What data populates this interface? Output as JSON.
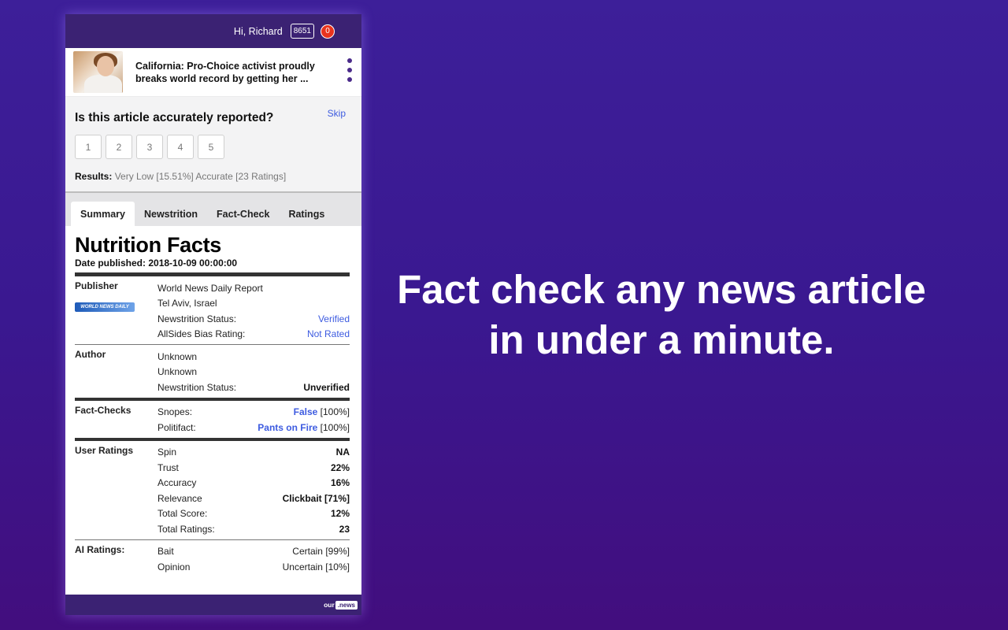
{
  "header": {
    "greeting": "Hi, Richard",
    "points": "8651",
    "notifications": "0"
  },
  "article": {
    "title": "California: Pro-Choice activist proudly breaks world record by getting her ..."
  },
  "rating": {
    "question": "Is this article accurately reported?",
    "skip_label": "Skip",
    "options": [
      "1",
      "2",
      "3",
      "4",
      "5"
    ],
    "results_label": "Results:",
    "results_text": "Very Low [15.51%] Accurate [23 Ratings]"
  },
  "tabs": [
    "Summary",
    "Newstrition",
    "Fact-Check",
    "Ratings"
  ],
  "facts": {
    "title": "Nutrition Facts",
    "date_published": "Date published: 2018-10-09 00:00:00",
    "publisher": {
      "label": "Publisher",
      "logo_text": "WORLD NEWS DAILY REPORT",
      "name": "World News Daily Report",
      "location": "Tel Aviv, Israel",
      "status_label": "Newstrition Status:",
      "status_value": "Verified",
      "bias_label": "AllSides Bias Rating:",
      "bias_value": "Not Rated"
    },
    "author": {
      "label": "Author",
      "name": "Unknown",
      "line2": "Unknown",
      "status_label": "Newstrition Status:",
      "status_value": "Unverified"
    },
    "fact_checks": {
      "label": "Fact-Checks",
      "rows": [
        {
          "source": "Snopes:",
          "verdict": "False",
          "pct": " [100%]"
        },
        {
          "source": "Politifact:",
          "verdict": "Pants on Fire",
          "pct": " [100%]"
        }
      ]
    },
    "user_ratings": {
      "label": "User Ratings",
      "rows": [
        {
          "name": "Spin",
          "value": "NA"
        },
        {
          "name": "Trust",
          "value": "22%"
        },
        {
          "name": "Accuracy",
          "value": "16%"
        },
        {
          "name": "Relevance",
          "value": "Clickbait [71%]"
        },
        {
          "name": "Total Score:",
          "value": "12%"
        },
        {
          "name": "Total Ratings:",
          "value": "23"
        }
      ]
    },
    "ai_ratings": {
      "label": "AI Ratings:",
      "rows": [
        {
          "name": "Bait",
          "value": "Certain [99%]"
        },
        {
          "name": "Opinion",
          "value": "Uncertain [10%]"
        }
      ]
    }
  },
  "footer": {
    "logo_our": "our",
    "logo_news": ".news"
  },
  "headline": "Fact check any news article in under a minute."
}
